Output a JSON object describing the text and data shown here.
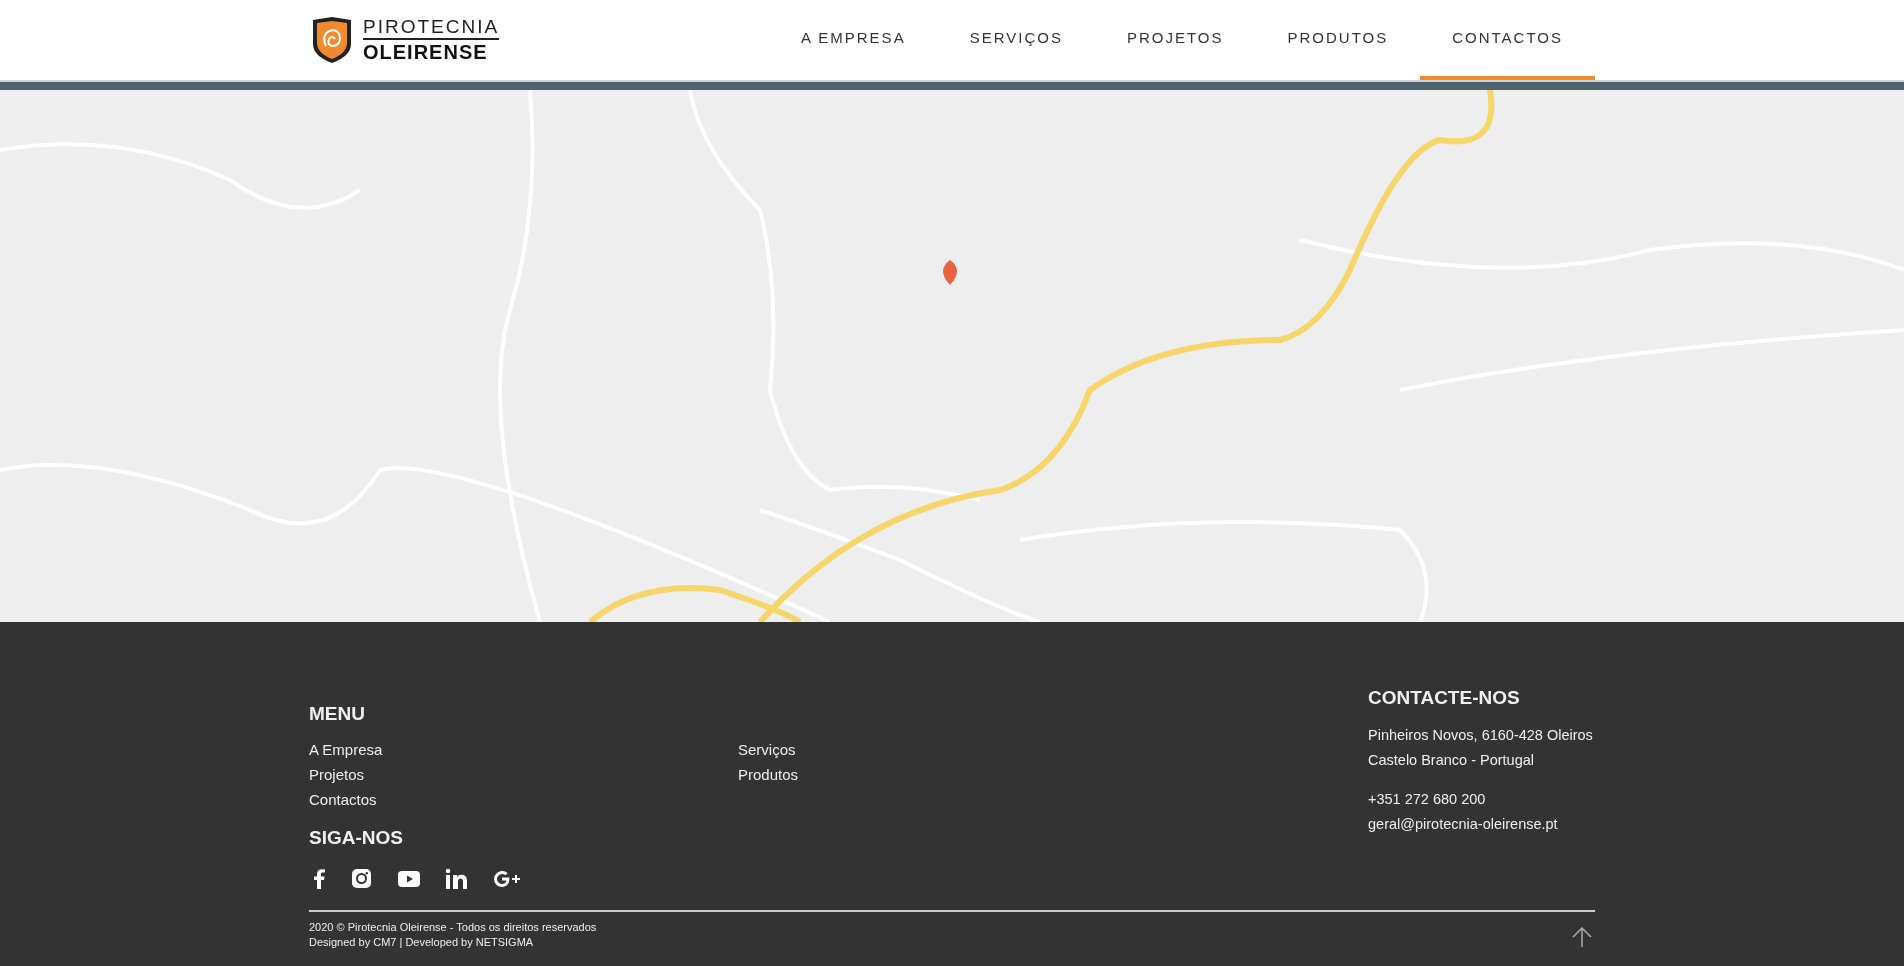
{
  "header": {
    "logo": {
      "line_1": "PIROTECNIA",
      "line_2": "OLEIRENSE"
    },
    "nav": [
      {
        "label": "A EMPRESA",
        "selected": false
      },
      {
        "label": "SERVIÇOS",
        "selected": false
      },
      {
        "label": "PROJETOS",
        "selected": false
      },
      {
        "label": "PRODUTOS",
        "selected": false
      },
      {
        "label": "CONTACTOS",
        "selected": true
      }
    ]
  },
  "footer": {
    "menu": {
      "title": "MENU",
      "columns": [
        [
          "A Empresa",
          "Projetos",
          "Contactos"
        ],
        [
          "Serviços",
          "Produtos"
        ]
      ]
    },
    "social": {
      "title": "SIGA-NOS"
    },
    "contact": {
      "title": "CONTACTE-NOS",
      "address": [
        "Pinheiros Novos, 6160-428 Oleiros",
        "Castelo Branco - Portugal"
      ],
      "phone": "+351 272 680 200",
      "email": "geral@pirotecnia-oleirense.pt"
    },
    "copyright": "2020 © Pirotecnia Oleirense - Todos os direitos reservados",
    "credits": "Designed by CM7 | Developed by NETSIGMA"
  }
}
